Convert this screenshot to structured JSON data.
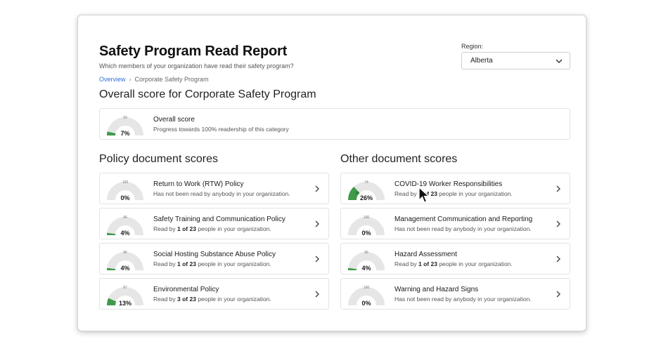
{
  "header": {
    "title": "Safety Program Read Report",
    "subtitle": "Which members of your organization have read their safety program?"
  },
  "breadcrumb": {
    "root": "Overview",
    "separator": "›",
    "current": "Corporate Safety Program"
  },
  "region": {
    "label": "Region:",
    "value": "Alberta"
  },
  "overall": {
    "heading": "Overall score for Corporate Safety Program",
    "card": {
      "title": "Overall score",
      "description": "Progress towards 100% readership of this category",
      "percent": 7,
      "percent_label": "7%",
      "top_value": "93",
      "fill_value": ""
    }
  },
  "policy": {
    "heading": "Policy document scores",
    "items": [
      {
        "title": "Return to Work (RTW) Policy",
        "desc_plain": "Has not been read by anybody in your organization.",
        "percent": 0,
        "percent_label": "0%",
        "top_value": "100",
        "fill_value": ""
      },
      {
        "title": "Safety Training and Communication Policy",
        "desc_prefix": "Read by ",
        "desc_count": "1 of 23",
        "desc_suffix": " people in your organization.",
        "percent": 4,
        "percent_label": "4%",
        "top_value": "96",
        "fill_value": ""
      },
      {
        "title": "Social Hosting Substance Abuse Policy",
        "desc_prefix": "Read by ",
        "desc_count": "1 of 23",
        "desc_suffix": " people in your organization.",
        "percent": 4,
        "percent_label": "4%",
        "top_value": "96",
        "fill_value": ""
      },
      {
        "title": "Environmental Policy",
        "desc_prefix": "Read by ",
        "desc_count": "3 of 23",
        "desc_suffix": " people in your organization.",
        "percent": 13,
        "percent_label": "13%",
        "top_value": "87",
        "fill_value": ""
      }
    ]
  },
  "other": {
    "heading": "Other document scores",
    "items": [
      {
        "title": "COVID-19 Worker Responsibilities",
        "desc_prefix": "Read by ",
        "desc_count": "6 of 23",
        "desc_suffix": " people in your organization.",
        "percent": 26,
        "percent_label": "26%",
        "top_value": "74",
        "fill_value": "26"
      },
      {
        "title": "Management Communication and Reporting",
        "desc_plain": "Has not been read by anybody in your organization.",
        "percent": 0,
        "percent_label": "0%",
        "top_value": "100",
        "fill_value": ""
      },
      {
        "title": "Hazard Assessment",
        "desc_prefix": "Read by ",
        "desc_count": "1 of 23",
        "desc_suffix": " people in your organization.",
        "percent": 4,
        "percent_label": "4%",
        "top_value": "96",
        "fill_value": ""
      },
      {
        "title": "Warning and Hazard Signs",
        "desc_plain": "Has not been read by anybody in your organization.",
        "percent": 0,
        "percent_label": "0%",
        "top_value": "100",
        "fill_value": ""
      }
    ]
  },
  "colors": {
    "gauge_fill": "#3f9b4a",
    "gauge_track": "#e6e6e6",
    "link": "#2f6fd6"
  },
  "icons": {
    "chevron": "chevron-right-icon",
    "dropdown": "chevron-down-icon",
    "cursor": "mouse-pointer-icon"
  }
}
